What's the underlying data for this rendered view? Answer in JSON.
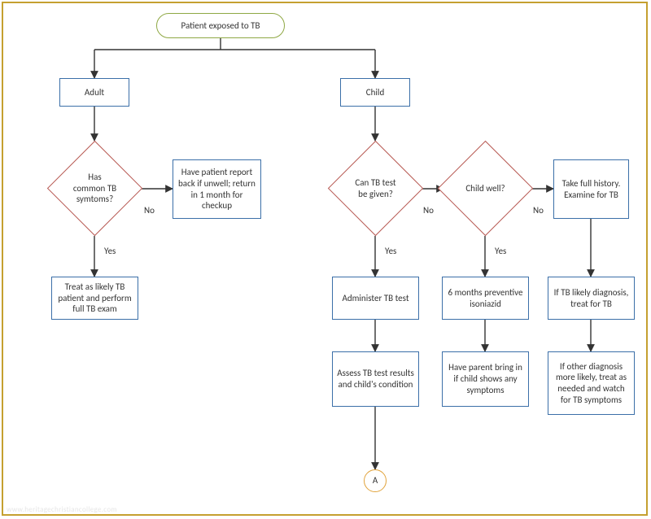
{
  "chart_data": {
    "type": "flowchart",
    "title": "",
    "nodes": [
      {
        "id": "start",
        "type": "terminator",
        "label": "Patient exposed to TB"
      },
      {
        "id": "adult",
        "type": "process",
        "label": "Adult"
      },
      {
        "id": "child",
        "type": "process",
        "label": "Child"
      },
      {
        "id": "q_symp",
        "type": "decision",
        "label": "Has common TB symtoms?"
      },
      {
        "id": "report",
        "type": "process",
        "label": "Have patient report back if unwell; return in 1 month for checkup"
      },
      {
        "id": "treat_ad",
        "type": "process",
        "label": "Treat as likely TB patient and perform full TB exam"
      },
      {
        "id": "q_test",
        "type": "decision",
        "label": "Can TB test be given?"
      },
      {
        "id": "q_well",
        "type": "decision",
        "label": "Child well?"
      },
      {
        "id": "hist",
        "type": "process",
        "label": "Take full history. Examine for TB"
      },
      {
        "id": "admin",
        "type": "process",
        "label": "Administer TB test"
      },
      {
        "id": "iso",
        "type": "process",
        "label": "6 months preventive isoniazid"
      },
      {
        "id": "tb_likely",
        "type": "process",
        "label": "If TB likely diagnosis, treat for TB"
      },
      {
        "id": "assess",
        "type": "process",
        "label": "Assess TB test results and child's condition"
      },
      {
        "id": "parent",
        "type": "process",
        "label": "Have parent bring in if child shows any symptoms"
      },
      {
        "id": "other_dx",
        "type": "process",
        "label": "If other diagnosis more likely, treat as needed and watch for TB symptoms"
      },
      {
        "id": "A",
        "type": "connector",
        "label": "A"
      }
    ],
    "edges": [
      {
        "from": "start",
        "to": "adult",
        "label": ""
      },
      {
        "from": "start",
        "to": "child",
        "label": ""
      },
      {
        "from": "adult",
        "to": "q_symp",
        "label": ""
      },
      {
        "from": "q_symp",
        "to": "report",
        "label": "No"
      },
      {
        "from": "q_symp",
        "to": "treat_ad",
        "label": "Yes"
      },
      {
        "from": "child",
        "to": "q_test",
        "label": ""
      },
      {
        "from": "q_test",
        "to": "q_well",
        "label": "No"
      },
      {
        "from": "q_test",
        "to": "admin",
        "label": "Yes"
      },
      {
        "from": "q_well",
        "to": "hist",
        "label": "No"
      },
      {
        "from": "q_well",
        "to": "iso",
        "label": "Yes"
      },
      {
        "from": "hist",
        "to": "tb_likely",
        "label": ""
      },
      {
        "from": "admin",
        "to": "assess",
        "label": ""
      },
      {
        "from": "iso",
        "to": "parent",
        "label": ""
      },
      {
        "from": "tb_likely",
        "to": "other_dx",
        "label": ""
      },
      {
        "from": "assess",
        "to": "A",
        "label": ""
      }
    ]
  },
  "labels": {
    "yes": "Yes",
    "no": "No"
  },
  "watermark": "www.heritagechristiancollege.com"
}
